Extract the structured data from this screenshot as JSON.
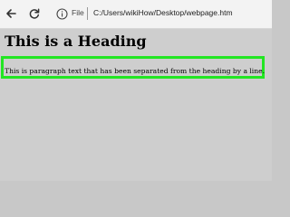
{
  "browser": {
    "scheme_label": "File",
    "url": "C:/Users/wikiHow/Desktop/webpage.htm"
  },
  "page": {
    "heading": "This is a Heading",
    "paragraph": "This is paragraph text that has been separated from the heading by a line."
  },
  "colors": {
    "highlight_border": "#22e622",
    "page_background": "#cecece",
    "toolbar_background": "#f3f3f3"
  },
  "icons": {
    "back": "arrow-left-icon",
    "refresh": "refresh-icon",
    "site_info": "info-icon"
  }
}
